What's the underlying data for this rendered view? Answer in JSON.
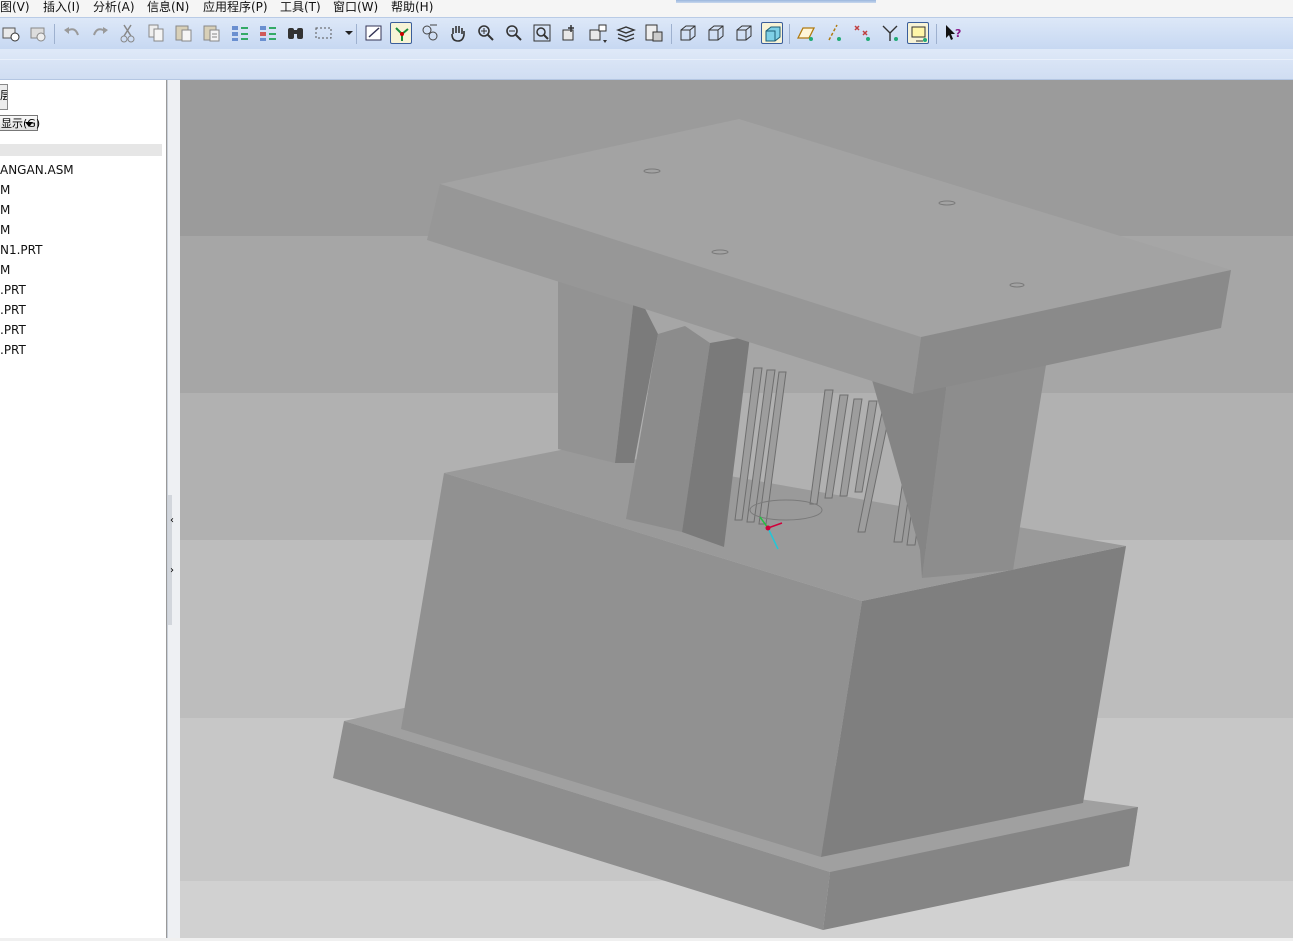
{
  "menu": {
    "view": "图(V)",
    "insert": "插入(I)",
    "analysis": "分析(A)",
    "info": "信息(N)",
    "applications": "应用程序(P)",
    "tools": "工具(T)",
    "window": "窗口(W)",
    "help": "帮助(H)"
  },
  "toolbar": {
    "buttons": [
      "regenerate-icon",
      "regenerate-manager-icon",
      "undo-icon",
      "redo-icon",
      "cut-icon",
      "copy-icon",
      "paste-icon",
      "paste-special-icon",
      "refit-icon",
      "redefine-icon",
      "search-icon",
      "select-box-icon",
      "repaint-icon",
      "spin-center-icon",
      "orient-mode-icon",
      "pan-icon",
      "zoom-in-icon",
      "zoom-out-icon",
      "refit-view-icon",
      "reorient-icon",
      "saved-views-icon",
      "layers-icon",
      "view-manager-icon",
      "wireframe-icon",
      "hidden-line-icon",
      "no-hidden-icon",
      "shading-icon",
      "datum-planes-icon",
      "datum-axes-icon",
      "datum-points-icon",
      "coordinate-systems-icon",
      "spin-center-display-icon",
      "context-help-icon"
    ]
  },
  "left_panel": {
    "tab": "层",
    "show_menu": "显示(G)",
    "tree_items": [
      "ANGAN.ASM",
      "M",
      "M",
      "M",
      "N1.PRT",
      "M",
      ".PRT",
      ".PRT",
      ".PRT",
      ".PRT"
    ]
  },
  "sash": {
    "collapse_glyph": "‹",
    "expand_glyph": "›"
  },
  "colors": {
    "viewport_band_dark": "#9b9b9b",
    "viewport_band_light": "#cfcfcf",
    "model_gray": "#8f8f8f",
    "toolbar_blue": "#d3e0f5"
  }
}
